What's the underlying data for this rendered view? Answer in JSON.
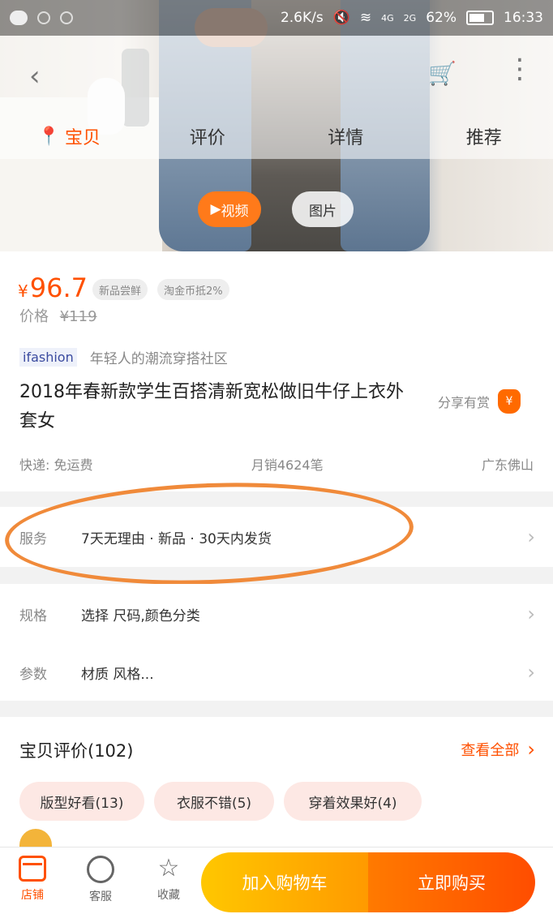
{
  "status_bar": {
    "speed": "2.6K/s",
    "network_labels": [
      "4G",
      "2G"
    ],
    "battery": "62%",
    "time": "16:33"
  },
  "top_nav": {
    "tabs": [
      {
        "label": "宝贝",
        "active": true
      },
      {
        "label": "评价",
        "active": false
      },
      {
        "label": "详情",
        "active": false
      },
      {
        "label": "推荐",
        "active": false
      }
    ]
  },
  "media": {
    "video_label": "视频",
    "photo_label": "图片"
  },
  "product": {
    "currency": "¥",
    "price": "96.7",
    "tags": [
      "新品尝鲜",
      "淘金币抵2%"
    ],
    "orig_label": "价格",
    "orig_price": "¥119",
    "brand_logo": "ifashion",
    "brand_slogan": "年轻人的潮流穿搭社区",
    "title": "2018年春新款学生百搭清新宽松做旧牛仔上衣外套女",
    "share_label": "分享有赏",
    "share_icon": "¥",
    "shipping": "快递: 免运费",
    "sales": "月销4624笔",
    "location": "广东佛山"
  },
  "rows": {
    "service_label": "服务",
    "service_value": "7天无理由 · 新品 · 30天内发货",
    "spec_label": "规格",
    "spec_value": "选择 尺码,颜色分类",
    "param_label": "参数",
    "param_value": "材质 风格..."
  },
  "annotation": {
    "color": "#f08a3a"
  },
  "reviews": {
    "title": "宝贝评价(102)",
    "view_all": "查看全部",
    "chips": [
      "版型好看(13)",
      "衣服不错(5)",
      "穿着效果好(4)"
    ]
  },
  "bottom_bar": {
    "shop": "店铺",
    "service": "客服",
    "favorite": "收藏",
    "add_to_cart": "加入购物车",
    "buy_now": "立即购买"
  },
  "colors": {
    "accent": "#ff5000",
    "cart_gradient": [
      "#ffc700",
      "#ff9a00"
    ],
    "buy_gradient": [
      "#ff7a00",
      "#ff4d00"
    ]
  }
}
